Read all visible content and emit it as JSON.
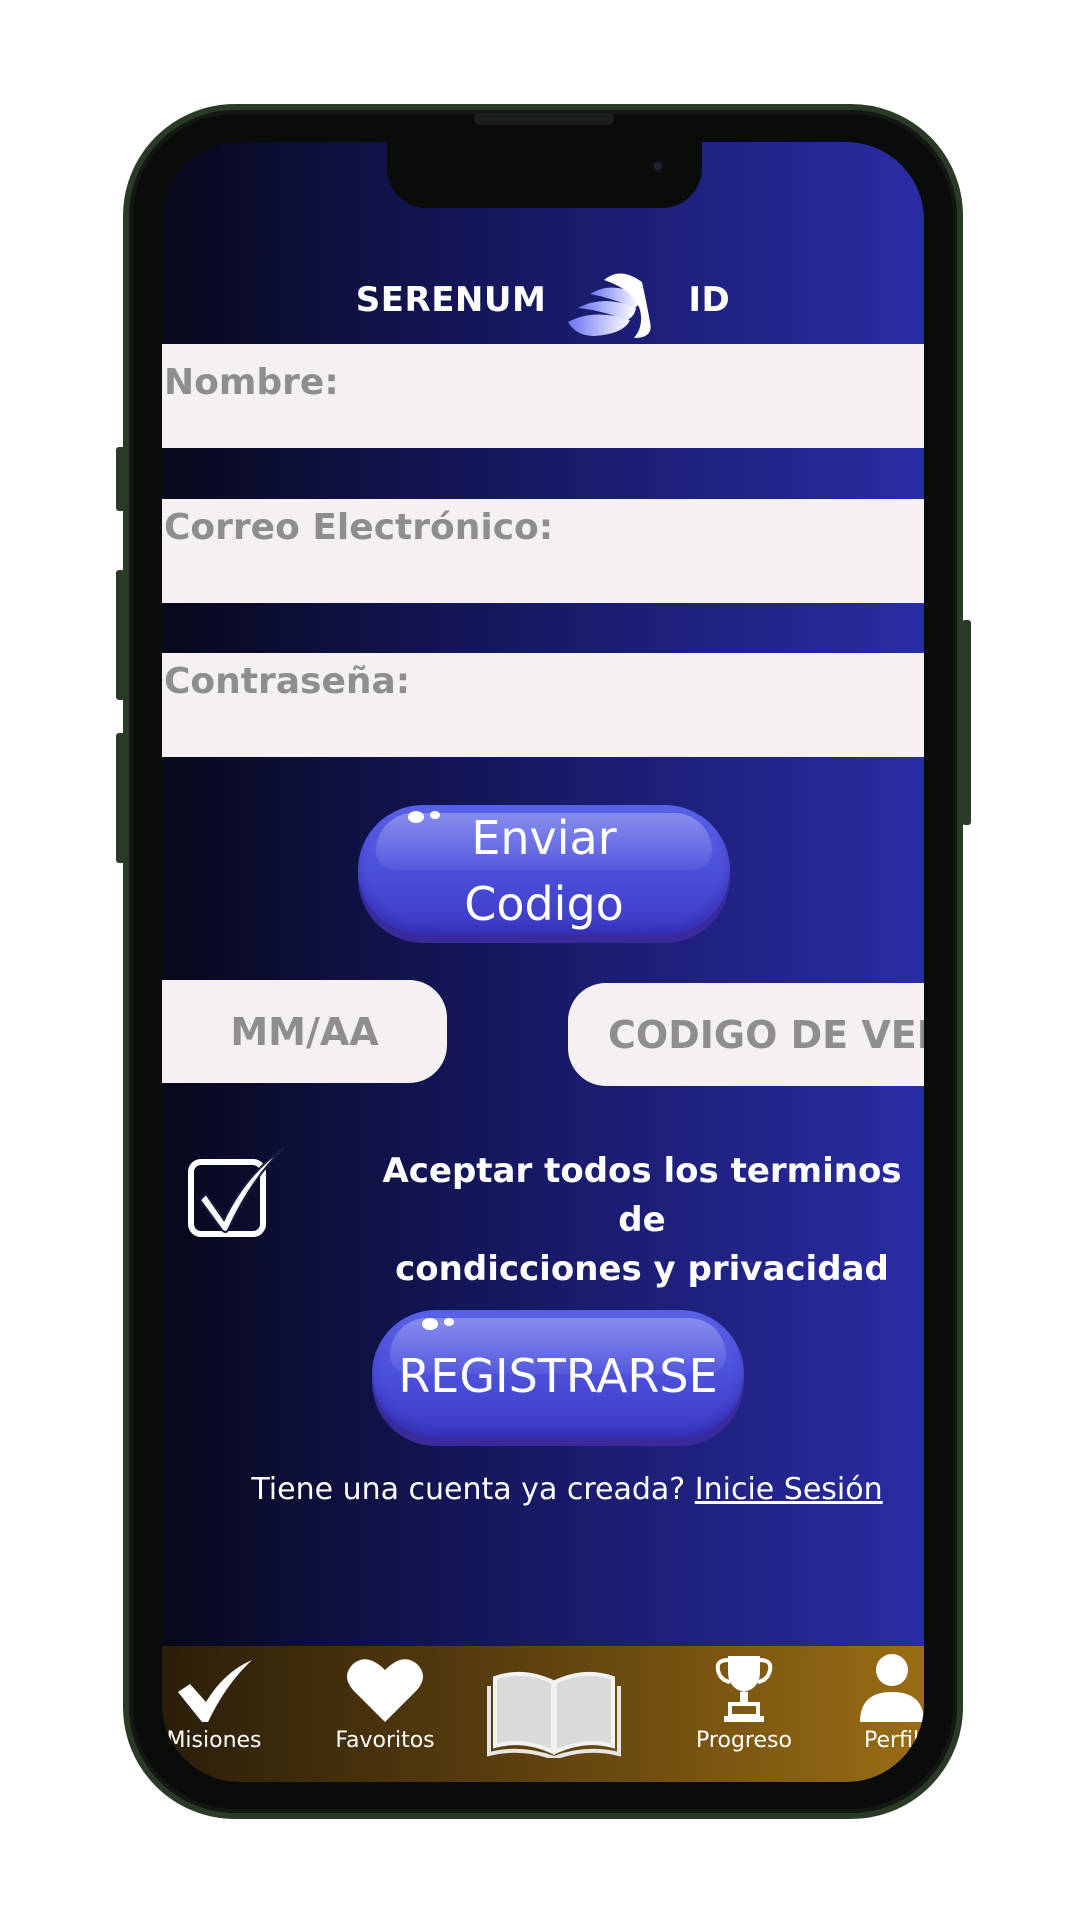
{
  "brand": {
    "left": "SERENUM",
    "right": "ID"
  },
  "form": {
    "name_label": "Nombre:",
    "email_label": "Correo Electrónico:",
    "password_label": "Contraseña:",
    "send_code_line1": "Enviar",
    "send_code_line2": "Codigo",
    "date_placeholder": "MM/AA",
    "verification_placeholder": "CODIGO DE VER.",
    "terms_line1": "Aceptar todos los terminos de",
    "terms_line2": "condicciones y privacidad",
    "terms_checked": true,
    "register_label": "REGISTRARSE",
    "have_account_text": "Tiene una cuenta ya creada? ",
    "login_link": "Inicie Sesión"
  },
  "bottom_nav": {
    "items": [
      {
        "label": "Misiones",
        "icon": "checkmark-icon"
      },
      {
        "label": "Favoritos",
        "icon": "heart-icon"
      },
      {
        "label": "",
        "icon": "book-icon"
      },
      {
        "label": "Progreso",
        "icon": "trophy-icon"
      },
      {
        "label": "Perfil",
        "icon": "user-icon"
      }
    ]
  },
  "colors": {
    "screen_gradient_start": "#07081a",
    "screen_gradient_end": "#2a2ca4",
    "button_blue": "#4a4ed9",
    "field_bg": "#f5f1f3",
    "label_gray": "#8f8d90",
    "nav_gold": "#9a6d14"
  }
}
